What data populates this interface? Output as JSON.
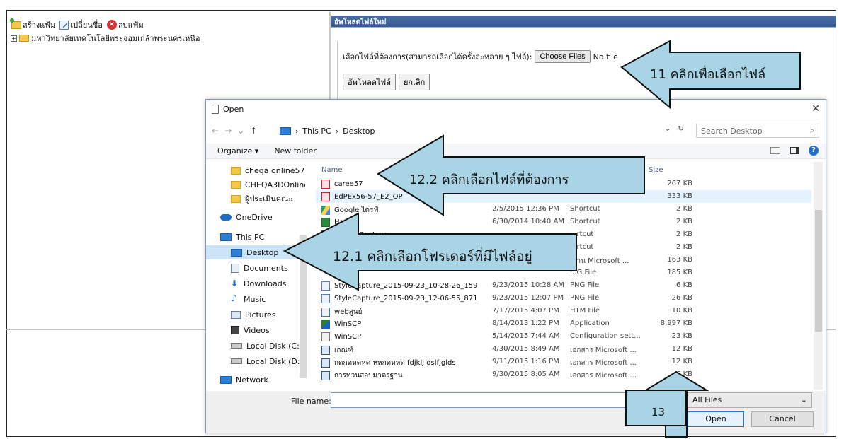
{
  "toolbar": {
    "new_folder": "สร้างแฟ้ม",
    "rename": "เปลี่ยนชื่อ",
    "delete": "ลบแฟ้ม"
  },
  "tree": {
    "root": "มหาวิทยาลัยเทคโนโลยีพระจอมเกล้าพระนครเหนือ"
  },
  "upload": {
    "header": "อัพโหลดไฟล์ใหม่",
    "select_label": "เลือกไฟล์ที่ต้องการ(สามารถเลือกได้ครั้งละหลาย ๆ ไฟล์):",
    "choose_button": "Choose Files",
    "no_file": "No file",
    "upload_button": "อัพโหลดไฟล์",
    "cancel_button": "ยกเลิก"
  },
  "dialog": {
    "title": "Open",
    "path": [
      "This PC",
      "Desktop"
    ],
    "search_placeholder": "Search Desktop",
    "organize": "Organize ▾",
    "new_folder": "New folder",
    "columns": {
      "name": "Name",
      "size": "Size"
    },
    "nav_items": [
      {
        "label": "cheqa online57",
        "icon": "folder-icon"
      },
      {
        "label": "CHEQA3DOnline",
        "icon": "folder-icon"
      },
      {
        "label": "ผู้ประเมินคณะ",
        "icon": "folder-icon"
      },
      {
        "label": "OneDrive",
        "icon": "onedrive-icon"
      },
      {
        "label": "This PC",
        "icon": "pc-icon"
      },
      {
        "label": "Desktop",
        "icon": "desktop-icon",
        "selected": true
      },
      {
        "label": "Documents",
        "icon": "documents-icon"
      },
      {
        "label": "Downloads",
        "icon": "downloads-icon"
      },
      {
        "label": "Music",
        "icon": "music-icon"
      },
      {
        "label": "Pictures",
        "icon": "pictures-icon"
      },
      {
        "label": "Videos",
        "icon": "videos-icon"
      },
      {
        "label": "Local Disk (C:)",
        "icon": "disk-icon"
      },
      {
        "label": "Local Disk (D:)",
        "icon": "disk-icon"
      },
      {
        "label": "Network",
        "icon": "network-icon"
      }
    ],
    "files": [
      {
        "name": "caree57",
        "date": "",
        "type": "",
        "size": "267 KB",
        "icon": "pdf"
      },
      {
        "name": "EdPEx56-57_E2_OP",
        "date": "",
        "type": "",
        "size": "333 KB",
        "icon": "pdf",
        "selected": true
      },
      {
        "name": "Google ไดรฟ์",
        "date": "2/5/2015 12:36 PM",
        "type": "Shortcut",
        "size": "2 KB",
        "icon": "gdrive"
      },
      {
        "name": "Hac...3",
        "date": "6/30/2014 10:40 AM",
        "type": "Shortcut",
        "size": "2 KB",
        "icon": "app"
      },
      {
        "name": "...StyleCapture",
        "date": "",
        "type": "...rtcut",
        "size": "2 KB",
        "icon": "app"
      },
      {
        "name": "",
        "date": "",
        "type": "...rtcut",
        "size": "2 KB",
        "icon": "cfg"
      },
      {
        "name": "",
        "date": "",
        "type": "...าน Microsoft ...",
        "size": "163 KB",
        "icon": "word"
      },
      {
        "name": "",
        "date": "",
        "type": "...G File",
        "size": "185 KB",
        "icon": "png"
      },
      {
        "name": "StyleCapture_2015-09-23_10-28-26_159",
        "date": "9/23/2015 10:28 AM",
        "type": "PNG File",
        "size": "6 KB",
        "icon": "png"
      },
      {
        "name": "StyleCapture_2015-09-23_12-06-55_871",
        "date": "9/23/2015 12:07 PM",
        "type": "PNG File",
        "size": "26 KB",
        "icon": "png"
      },
      {
        "name": "webสูนย์",
        "date": "7/17/2015 4:07 PM",
        "type": "HTM File",
        "size": "10 KB",
        "icon": "htm"
      },
      {
        "name": "WinSCP",
        "date": "8/14/2013 1:22 PM",
        "type": "Application",
        "size": "8,997 KB",
        "icon": "winscp"
      },
      {
        "name": "WinSCP",
        "date": "5/14/2015 7:44 AM",
        "type": "Configuration sett...",
        "size": "23 KB",
        "icon": "cfg"
      },
      {
        "name": "เกณฑ์",
        "date": "4/30/2015 8:49 AM",
        "type": "เอกสาร Microsoft ...",
        "size": "12 KB",
        "icon": "word"
      },
      {
        "name": "กดกดหดหด หหกดหหด fdjklj dslfjglds",
        "date": "9/11/2015 1:16 PM",
        "type": "เอกสาร Microsoft ...",
        "size": "12 KB",
        "icon": "word"
      },
      {
        "name": "การทวนสอบมาตรฐาน",
        "date": "9/30/2015 8:05 AM",
        "type": "เอกสาร Microsoft ...",
        "size": "...6 KB",
        "icon": "word"
      }
    ],
    "file_name_label": "File name:",
    "file_name_value": "",
    "filter": "All Files",
    "open_button": "Open",
    "cancel_button": "Cancel"
  },
  "annotations": {
    "step11": "11 คลิกเพื่อเลือกไฟล์",
    "step12_2": "12.2 คลิกเลือกไฟล์ที่ต้องการ",
    "step12_1": "12.1 คลิกเลือกโฟรเดอร์ที่มีไฟล์อยู่",
    "step13": "13",
    "arrow_color": "#a8d4e6"
  }
}
